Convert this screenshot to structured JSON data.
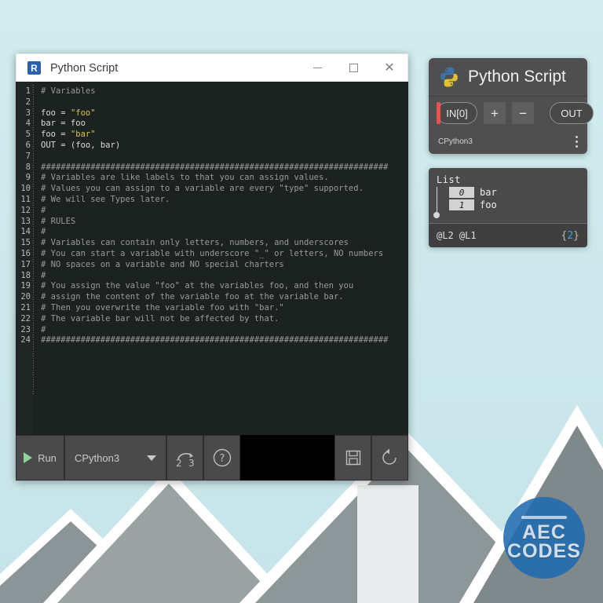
{
  "window": {
    "title": "Python Script",
    "icon": "rhino-r-icon",
    "controls": {
      "minimize": "minimize-icon",
      "maximize": "maximize-icon",
      "close": "close-icon"
    }
  },
  "editor": {
    "line_numbers": [
      "1",
      "2",
      "3",
      "4",
      "5",
      "6",
      "7",
      "8",
      "9",
      "10",
      "11",
      "12",
      "13",
      "14",
      "15",
      "16",
      "17",
      "18",
      "19",
      "20",
      "21",
      "22",
      "23",
      "24"
    ],
    "lines": [
      {
        "n": 1,
        "segments": [
          {
            "t": "# Variables",
            "c": "cmt"
          }
        ]
      },
      {
        "n": 2,
        "segments": [
          {
            "t": "",
            "c": "txt"
          }
        ]
      },
      {
        "n": 3,
        "segments": [
          {
            "t": "foo = ",
            "c": "txt"
          },
          {
            "t": "\"foo\"",
            "c": "str"
          }
        ]
      },
      {
        "n": 4,
        "segments": [
          {
            "t": "bar = foo",
            "c": "txt"
          }
        ]
      },
      {
        "n": 5,
        "segments": [
          {
            "t": "foo = ",
            "c": "txt"
          },
          {
            "t": "\"bar\"",
            "c": "str"
          }
        ]
      },
      {
        "n": 6,
        "segments": [
          {
            "t": "OUT = (foo, bar)",
            "c": "txt"
          }
        ]
      },
      {
        "n": 7,
        "segments": [
          {
            "t": "",
            "c": "txt"
          }
        ]
      },
      {
        "n": 8,
        "segments": [
          {
            "t": "######################################################################",
            "c": "cmt"
          }
        ]
      },
      {
        "n": 9,
        "segments": [
          {
            "t": "# Variables are like labels to that you can assign values.",
            "c": "cmt"
          }
        ]
      },
      {
        "n": 10,
        "segments": [
          {
            "t": "# Values you can assign to a variable are every \"type\" supported.",
            "c": "cmt"
          }
        ]
      },
      {
        "n": 11,
        "segments": [
          {
            "t": "# We will see Types later.",
            "c": "cmt"
          }
        ]
      },
      {
        "n": 12,
        "segments": [
          {
            "t": "#",
            "c": "cmt"
          }
        ]
      },
      {
        "n": 13,
        "segments": [
          {
            "t": "# RULES",
            "c": "cmt"
          }
        ]
      },
      {
        "n": 14,
        "segments": [
          {
            "t": "#",
            "c": "cmt"
          }
        ]
      },
      {
        "n": 15,
        "segments": [
          {
            "t": "# Variables can contain only letters, numbers, and underscores",
            "c": "cmt"
          }
        ]
      },
      {
        "n": 16,
        "segments": [
          {
            "t": "# You can start a variable with underscore \"_\" or letters, NO numbers",
            "c": "cmt"
          }
        ]
      },
      {
        "n": 17,
        "segments": [
          {
            "t": "# NO spaces on a variable and NO special charters",
            "c": "cmt"
          }
        ]
      },
      {
        "n": 18,
        "segments": [
          {
            "t": "#",
            "c": "cmt"
          }
        ]
      },
      {
        "n": 19,
        "segments": [
          {
            "t": "# You assign the value \"foo\" at the variables foo, and then you",
            "c": "cmt"
          }
        ]
      },
      {
        "n": 20,
        "segments": [
          {
            "t": "# assign the content of the variable foo at the variable bar.",
            "c": "cmt"
          }
        ]
      },
      {
        "n": 21,
        "segments": [
          {
            "t": "# Then you overwrite the variable foo with \"bar.\"",
            "c": "cmt"
          }
        ]
      },
      {
        "n": 22,
        "segments": [
          {
            "t": "# The variable bar will not be affected by that.",
            "c": "cmt"
          }
        ]
      },
      {
        "n": 23,
        "segments": [
          {
            "t": "#",
            "c": "cmt"
          }
        ]
      },
      {
        "n": 24,
        "segments": [
          {
            "t": "######################################################################",
            "c": "cmt"
          }
        ]
      }
    ]
  },
  "toolbar": {
    "run_label": "Run",
    "interpreter_value": "CPython3",
    "convert_label": "2 3",
    "convert_icon": "python-2to3-icon",
    "help_icon": "question-mark-icon",
    "save_icon": "floppy-save-icon",
    "reset_icon": "reset-arrow-icon",
    "run_icon": "play-triangle-icon",
    "dropdown_icon": "chevron-down-icon"
  },
  "component": {
    "title": "Python Script",
    "logo_icon": "python-logo-icon",
    "input_port": "IN[0]",
    "add_label": "+",
    "remove_label": "−",
    "output_port": "OUT",
    "footer_text": "CPython3",
    "menu_icon": "kebab-menu-icon"
  },
  "list_panel": {
    "title": "List",
    "items": [
      {
        "index": "0",
        "value": "bar"
      },
      {
        "index": "1",
        "value": "foo"
      }
    ],
    "paths": "@L2 @L1",
    "count_prefix": "{",
    "count": "2",
    "count_suffix": "}"
  },
  "watermark": {
    "line1": "AEC",
    "line2": "CODES",
    "color": "#1f6cb0"
  },
  "colors": {
    "sky": "#cbe8ec",
    "editor_bg": "#1c2220",
    "string": "#d7c44c",
    "comment": "#9a9a9a",
    "accent_red": "#e8534f",
    "accent_cyan": "#2aa8e0"
  }
}
